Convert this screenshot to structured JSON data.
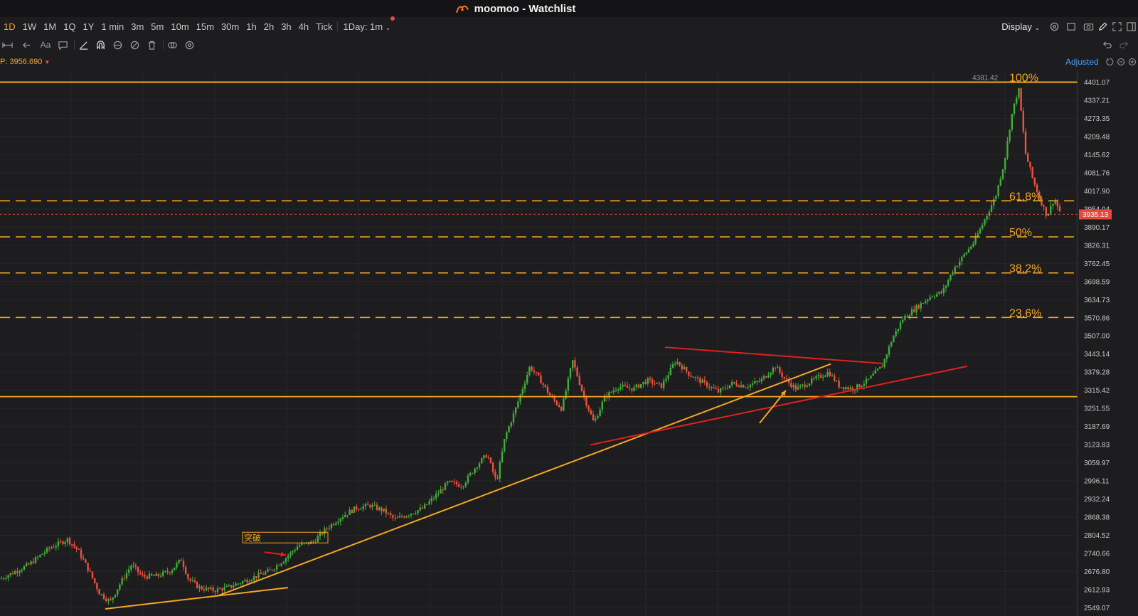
{
  "window": {
    "title": "moomoo - Watchlist"
  },
  "toolbar": {
    "timeframes": [
      "1D",
      "1W",
      "1M",
      "1Q",
      "1Y",
      "1 min",
      "3m",
      "5m",
      "10m",
      "15m",
      "30m",
      "1h",
      "2h",
      "3h",
      "4h",
      "Tick"
    ],
    "active_timeframe": "1D",
    "interval_dropdown": "1Day: 1m",
    "display_label": "Display"
  },
  "info": {
    "price_readout": "P:  3956.690",
    "adjusted_label": "Adjusted"
  },
  "colors": {
    "up": "#3fae3a",
    "down": "#f0503c",
    "accent": "#f5a623",
    "trend_red": "#e02020",
    "background": "#1d1d1f"
  },
  "chart_data": {
    "type": "candlestick",
    "y_axis_ticks": [
      4401.07,
      4337.21,
      4273.35,
      4209.48,
      4145.62,
      4081.76,
      4017.9,
      3954.04,
      3890.17,
      3826.31,
      3762.45,
      3698.59,
      3634.73,
      3570.86,
      3507.0,
      3443.14,
      3379.28,
      3315.42,
      3251.55,
      3187.69,
      3123.83,
      3059.97,
      2996.11,
      2932.24,
      2868.38,
      2804.52,
      2740.66,
      2676.8,
      2612.93,
      2549.07
    ],
    "ylim": [
      2545,
      4415
    ],
    "high_label": "4381.42",
    "last_price": "3935.13",
    "fibonacci_levels": [
      {
        "label": "100%",
        "price": 4401.07,
        "style": "solid"
      },
      {
        "label": "61.8%",
        "price": 3983.0,
        "style": "dashed"
      },
      {
        "label": "50%",
        "price": 3856.0,
        "style": "dashed"
      },
      {
        "label": "38.2%",
        "price": 3729.0,
        "style": "dashed"
      },
      {
        "label": "23.6%",
        "price": 3572.0,
        "style": "dashed"
      }
    ],
    "support_level": 3293.0,
    "annotation": "突破",
    "price_path": [
      [
        0,
        2650
      ],
      [
        40,
        2700
      ],
      [
        70,
        2760
      ],
      [
        95,
        2790
      ],
      [
        110,
        2750
      ],
      [
        125,
        2680
      ],
      [
        140,
        2600
      ],
      [
        155,
        2570
      ],
      [
        170,
        2640
      ],
      [
        185,
        2700
      ],
      [
        200,
        2660
      ],
      [
        220,
        2660
      ],
      [
        240,
        2680
      ],
      [
        255,
        2720
      ],
      [
        265,
        2650
      ],
      [
        280,
        2620
      ],
      [
        300,
        2610
      ],
      [
        320,
        2620
      ],
      [
        340,
        2640
      ],
      [
        360,
        2660
      ],
      [
        380,
        2680
      ],
      [
        400,
        2720
      ],
      [
        420,
        2770
      ],
      [
        440,
        2780
      ],
      [
        460,
        2830
      ],
      [
        480,
        2870
      ],
      [
        500,
        2900
      ],
      [
        520,
        2910
      ],
      [
        540,
        2890
      ],
      [
        555,
        2860
      ],
      [
        575,
        2880
      ],
      [
        595,
        2900
      ],
      [
        615,
        2950
      ],
      [
        630,
        2990
      ],
      [
        650,
        2980
      ],
      [
        670,
        3050
      ],
      [
        685,
        3090
      ],
      [
        698,
        2990
      ],
      [
        710,
        3150
      ],
      [
        725,
        3250
      ],
      [
        745,
        3400
      ],
      [
        760,
        3350
      ],
      [
        775,
        3290
      ],
      [
        790,
        3250
      ],
      [
        805,
        3420
      ],
      [
        820,
        3300
      ],
      [
        835,
        3200
      ],
      [
        850,
        3290
      ],
      [
        870,
        3330
      ],
      [
        890,
        3320
      ],
      [
        910,
        3350
      ],
      [
        930,
        3330
      ],
      [
        950,
        3420
      ],
      [
        970,
        3370
      ],
      [
        990,
        3340
      ],
      [
        1010,
        3310
      ],
      [
        1030,
        3340
      ],
      [
        1050,
        3330
      ],
      [
        1070,
        3350
      ],
      [
        1090,
        3400
      ],
      [
        1105,
        3350
      ],
      [
        1120,
        3320
      ],
      [
        1135,
        3340
      ],
      [
        1150,
        3360
      ],
      [
        1165,
        3380
      ],
      [
        1180,
        3330
      ],
      [
        1200,
        3320
      ],
      [
        1220,
        3350
      ],
      [
        1240,
        3400
      ],
      [
        1255,
        3500
      ],
      [
        1270,
        3570
      ],
      [
        1290,
        3610
      ],
      [
        1310,
        3650
      ],
      [
        1325,
        3660
      ],
      [
        1340,
        3740
      ],
      [
        1355,
        3790
      ],
      [
        1370,
        3840
      ],
      [
        1385,
        3920
      ],
      [
        1400,
        4000
      ],
      [
        1412,
        4120
      ],
      [
        1422,
        4280
      ],
      [
        1432,
        4381
      ],
      [
        1442,
        4150
      ],
      [
        1452,
        4060
      ],
      [
        1462,
        3990
      ],
      [
        1472,
        3930
      ],
      [
        1482,
        3990
      ],
      [
        1492,
        3935
      ]
    ],
    "trendlines": [
      {
        "color": "orange",
        "from": [
          148,
          2545
        ],
        "to": [
          405,
          2620
        ]
      },
      {
        "color": "orange",
        "from": [
          305,
          2590
        ],
        "to": [
          1168,
          3408
        ]
      },
      {
        "color": "red",
        "from": [
          935,
          3467
        ],
        "to": [
          1240,
          3410
        ]
      },
      {
        "color": "red",
        "from": [
          830,
          3123
        ],
        "to": [
          1360,
          3400
        ]
      }
    ],
    "arrows": [
      {
        "color": "orange",
        "from": [
          1068,
          3200
        ],
        "to": [
          1105,
          3315
        ]
      },
      {
        "color": "red",
        "from": [
          372,
          2745
        ],
        "to": [
          402,
          2735
        ]
      }
    ]
  }
}
